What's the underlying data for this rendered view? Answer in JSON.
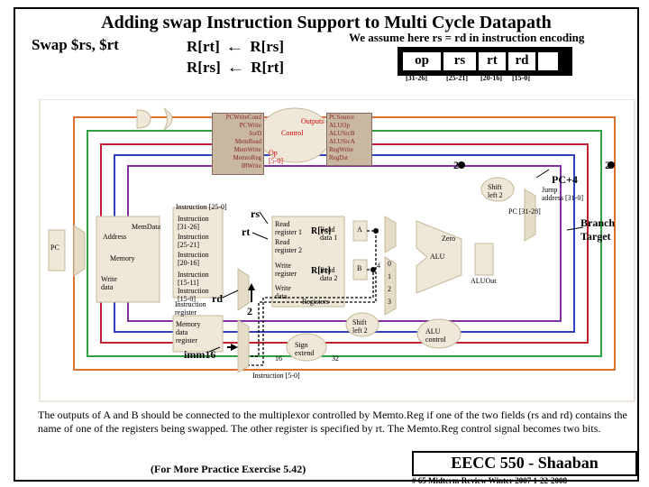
{
  "title": "Adding swap Instruction Support to Multi Cycle Datapath",
  "swap_instr": "Swap  $rs, $rt",
  "assume": "We assume here  rs = rd   in instruction encoding",
  "rtl": {
    "line1a": "R[rt]",
    "line1b": "R[rs]",
    "line2a": "R[rs]",
    "line2b": "R[rt]"
  },
  "fields": {
    "op": "op",
    "rs": "rs",
    "rt": "rt",
    "rd": "rd"
  },
  "bits": {
    "op": "[31-26]",
    "rs": "[25-21]",
    "rt": "[20-16]",
    "rd": "[15-0]"
  },
  "dp": {
    "rs": "rs",
    "rt": "rt",
    "rd": "rd",
    "Rrs": "R[rs]",
    "Rrt": "R[rt]",
    "imm16": "imm16",
    "two_a": "2",
    "two_b": "2",
    "two_c": "2",
    "pc4": "PC+4",
    "branch": "Branch\nTarget",
    "pc": "PC",
    "mem": "Memory",
    "addr": "Address",
    "wdata": "Write\ndata",
    "memdata": "MemData",
    "ir": "Instruction\nregister",
    "mdr": "Memory\ndata\nregister",
    "i2520": "Instruction [25-0]",
    "i3126": "Instruction\n[31-26]",
    "i2521": "Instruction\n[25-21]",
    "i2016": "Instruction\n[20-16]",
    "i1511": "Instruction\n[15-11]",
    "i150": "Instruction\n[15-0]",
    "i50": "Instruction [5-0]",
    "rf": "Registers",
    "rr1": "Read\nregister 1",
    "rr2": "Read\nregister 2",
    "wr": "Write\nregister",
    "wd": "Write\ndata",
    "rd1": "Read\ndata 1",
    "rd2": "Read\ndata 2",
    "a": "A",
    "b": "B",
    "signext": "Sign\nextend",
    "sl2a": "Shift\nleft 2",
    "sl2b": "Shift\nleft 2",
    "alu": "ALU",
    "aluout": "ALUOut",
    "zero": "Zero",
    "aluctl": "ALU\ncontrol",
    "jaddr": "Jump\naddress [31-0]",
    "pc3128": "PC [31-28]",
    "control": "Control",
    "m01": "0",
    "m1": "1",
    "m2": "2",
    "m3": "3",
    "four": "4",
    "sigs": [
      "PCWriteCond",
      "PCWrite",
      "IorD",
      "MemRead",
      "MemWrite",
      "MemtoReg",
      "IRWrite",
      "PCSource",
      "ALUOp",
      "ALUSrcB",
      "ALUSrcA",
      "RegWrite",
      "RegDst"
    ],
    "op": "Op\n[5-0]",
    "outputs": "Outputs",
    "sixteen": "16",
    "thirtytwo": "32"
  },
  "note_text": "The outputs of A and B should be connected to the multiplexor controlled by Memto.Reg if one of the two fields (rs and rd) contains the name of one of the registers being swapped.  The other register is specified by rt.  The Memto.Reg control signal becomes two bits.",
  "practice": "(For More Practice Exercise 5.42)",
  "course": "EECC 550 - Shaaban",
  "slide_footer": "# 65   Midterm  Review   Winter 2007  1-22-2008"
}
